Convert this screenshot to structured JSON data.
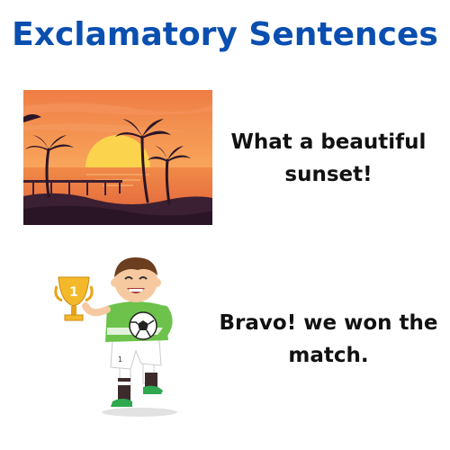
{
  "title": "Exclamatory Sentences",
  "examples": [
    {
      "sentence_line1": "What a beautiful",
      "sentence_line2": "sunset!",
      "illustration": "sunset-with-palm-trees"
    },
    {
      "sentence_line1": "Bravo! we won the",
      "sentence_line2": "match.",
      "illustration": "boy-with-trophy-and-football"
    }
  ],
  "colors": {
    "title": "#0a4fb0",
    "text": "#111111"
  }
}
